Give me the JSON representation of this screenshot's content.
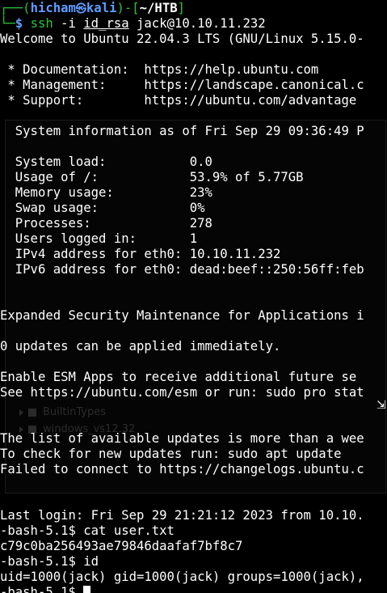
{
  "prompt": {
    "corner_top": "┌──(",
    "user": "hicham",
    "at_icon": "㉿",
    "host": "kali",
    "mid": ")-[",
    "path": "~/HTB",
    "end": "]",
    "corner_bottom": "└─",
    "dollar": "$",
    "cmd_name": "ssh",
    "flag": "-i",
    "key_file": "id_rsa",
    "target": "jack@10.10.11.232"
  },
  "output_lines": [
    "Welcome to Ubuntu 22.04.3 LTS (GNU/Linux 5.15.0-",
    "",
    " * Documentation:  https://help.ubuntu.com",
    " * Management:     https://landscape.canonical.c",
    " * Support:        https://ubuntu.com/advantage",
    "",
    "  System information as of Fri Sep 29 09:36:49 P",
    "",
    "  System load:           0.0",
    "  Usage of /:            53.9% of 5.77GB",
    "  Memory usage:          23%",
    "  Swap usage:            0%",
    "  Processes:             278",
    "  Users logged in:       1",
    "  IPv4 address for eth0: 10.10.11.232",
    "  IPv6 address for eth0: dead:beef::250:56ff:feb",
    "",
    "",
    "Expanded Security Maintenance for Applications i",
    "",
    "0 updates can be applied immediately.",
    "",
    "Enable ESM Apps to receive additional future se",
    "See https://ubuntu.com/esm or run: sudo pro stat",
    "",
    "",
    "The list of available updates is more than a wee",
    "To check for new updates run: sudo apt update",
    "Failed to connect to https://changelogs.ubuntu.c",
    "",
    "",
    "Last login: Fri Sep 29 21:21:12 2023 from 10.10.",
    "-bash-5.1$ cat user.txt",
    "c79c0ba256493ae79846daafaf7bf8c7",
    "-bash-5.1$ id",
    "uid=1000(jack) gid=1000(jack) groups=1000(jack),"
  ],
  "final_prompt": "-bash-5.1$ ",
  "ghost": {
    "row1": "BuiltinTypes",
    "row2": "windows_vs12.32"
  },
  "colors": {
    "background": "#000000",
    "prompt_green": "#2ac33a",
    "prompt_blue": "#5f9dff",
    "text": "#ffffff"
  }
}
